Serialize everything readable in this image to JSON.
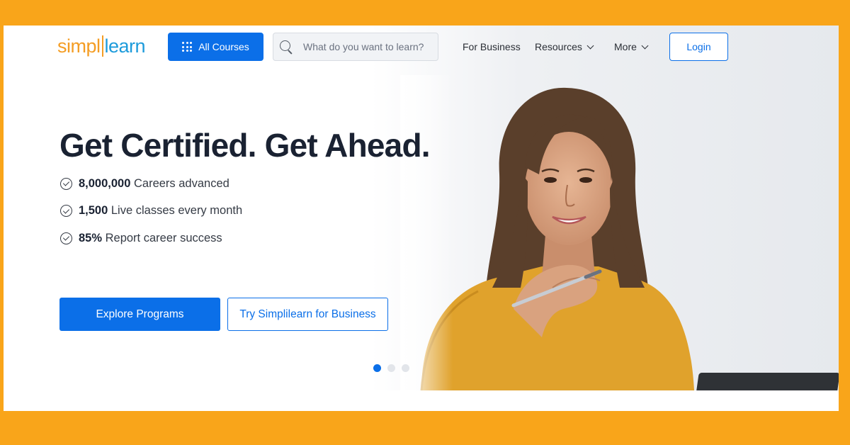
{
  "brand": {
    "logo_part1": "simpl",
    "logo_part2": "learn"
  },
  "header": {
    "all_courses_label": "All Courses",
    "search_placeholder": "What do you want to learn?",
    "nav": {
      "for_business": "For Business",
      "resources": "Resources",
      "more": "More"
    },
    "login_label": "Login"
  },
  "hero": {
    "headline": "Get Certified. Get Ahead.",
    "stats": [
      {
        "value": "8,000,000",
        "text": " Careers advanced"
      },
      {
        "value": "1,500",
        "text": " Live classes every month"
      },
      {
        "value": "85%",
        "text": " Report career success"
      }
    ],
    "primary_cta": "Explore Programs",
    "secondary_cta": "Try Simplilearn for Business",
    "carousel_active_index": 1,
    "carousel_count": 3
  },
  "colors": {
    "accent": "#0B6FE8",
    "page_border": "#F9A51A",
    "logo_orange": "#F49D24",
    "logo_blue": "#1D9BDB"
  }
}
